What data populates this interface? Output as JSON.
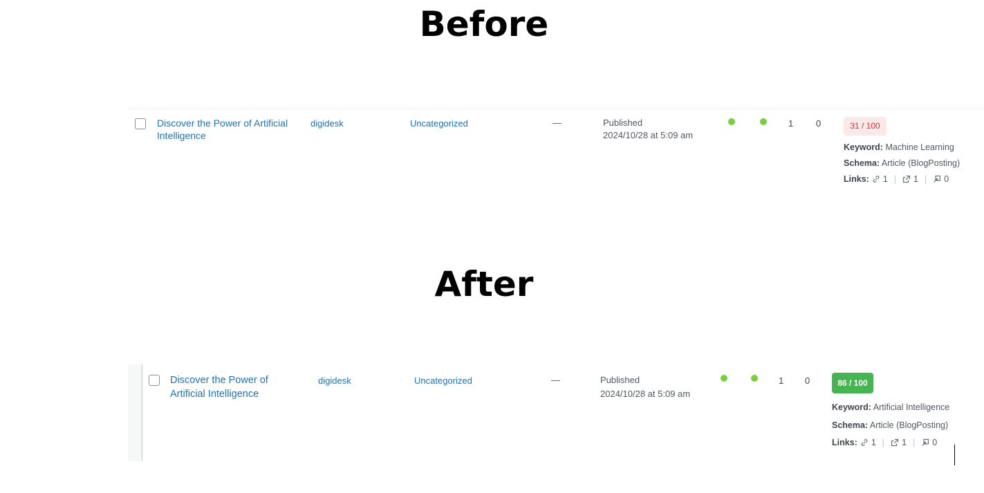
{
  "headings": {
    "before": "Before",
    "after": "After"
  },
  "colors": {
    "link": "#2271b1",
    "dot": "#7ad03a",
    "bad_score_bg": "#fbe8e8",
    "bad_score_text": "#dc3232",
    "good_score_bg": "#46b450"
  },
  "before": {
    "title": "Discover the Power of Artificial Intelligence",
    "author": "digidesk",
    "category": "Uncategorized",
    "tags": "—",
    "status": "Published",
    "date": "2024/10/28 at 5:09 am",
    "count1": "1",
    "count2": "0",
    "seo_score": "31 / 100",
    "keyword_label": "Keyword:",
    "keyword": "Machine Learning",
    "schema_label": "Schema:",
    "schema": "Article (BlogPosting)",
    "links_label": "Links:",
    "links_internal": "1",
    "links_external": "1",
    "links_incoming": "0",
    "separator": "|"
  },
  "after": {
    "title": "Discover the Power of Artificial Intelligence",
    "author": "digidesk",
    "category": "Uncategorized",
    "tags": "—",
    "status": "Published",
    "date": "2024/10/28 at 5:09 am",
    "count1": "1",
    "count2": "0",
    "seo_score": "86 / 100",
    "keyword_label": "Keyword:",
    "keyword": "Artificial Intelligence",
    "schema_label": "Schema:",
    "schema": "Article (BlogPosting)",
    "links_label": "Links:",
    "links_internal": "1",
    "links_external": "1",
    "links_incoming": "0",
    "separator": "|"
  }
}
